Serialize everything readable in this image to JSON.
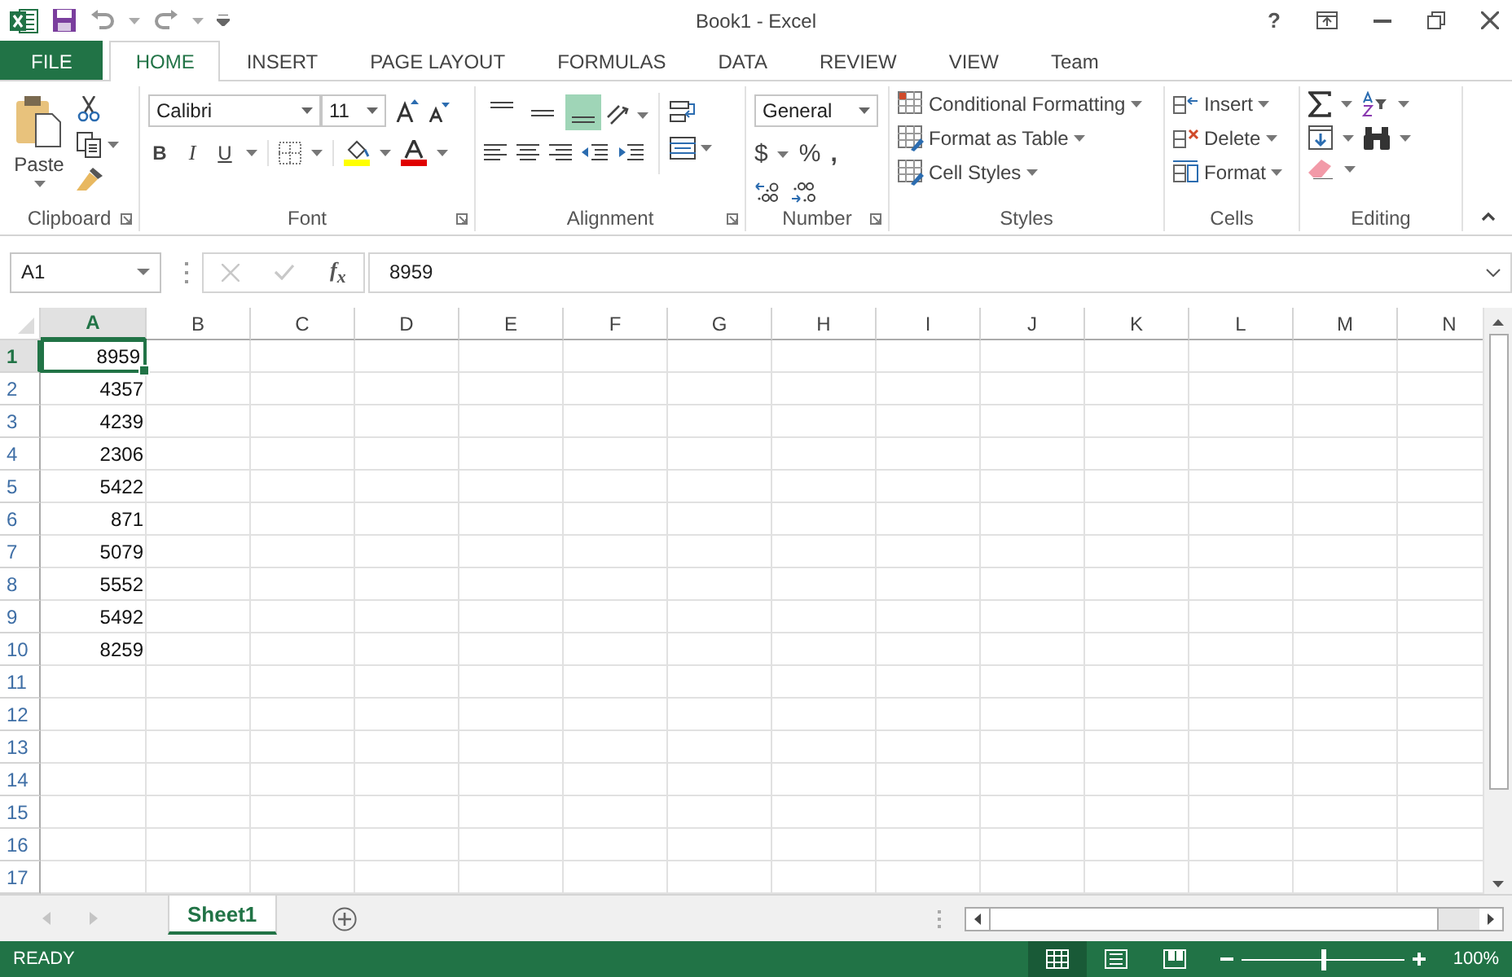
{
  "window": {
    "title": "Book1 - Excel",
    "help": "?"
  },
  "tabs": [
    {
      "label": "FILE",
      "kind": "file",
      "selected": false
    },
    {
      "label": "HOME",
      "kind": "tab",
      "selected": true
    },
    {
      "label": "INSERT",
      "kind": "tab",
      "selected": false
    },
    {
      "label": "PAGE LAYOUT",
      "kind": "tab",
      "selected": false
    },
    {
      "label": "FORMULAS",
      "kind": "tab",
      "selected": false
    },
    {
      "label": "DATA",
      "kind": "tab",
      "selected": false
    },
    {
      "label": "REVIEW",
      "kind": "tab",
      "selected": false
    },
    {
      "label": "VIEW",
      "kind": "tab",
      "selected": false
    },
    {
      "label": "Team",
      "kind": "tab",
      "selected": false
    }
  ],
  "ribbon": {
    "clipboard": {
      "label": "Clipboard",
      "paste": "Paste"
    },
    "font": {
      "label": "Font",
      "font_name": "Calibri",
      "font_size": "11",
      "style_buttons": [
        "B",
        "I",
        "U"
      ]
    },
    "alignment": {
      "label": "Alignment",
      "vertical_buttons": [
        {
          "kind": "top",
          "selected": false
        },
        {
          "kind": "middle",
          "selected": false
        },
        {
          "kind": "bottom",
          "selected": true
        }
      ]
    },
    "number": {
      "label": "Number",
      "format": "General",
      "currency": "$",
      "percent": "%",
      "comma": ","
    },
    "styles": {
      "label": "Styles",
      "items": [
        "Conditional Formatting",
        "Format as Table",
        "Cell Styles"
      ]
    },
    "cells": {
      "label": "Cells",
      "items": [
        "Insert",
        "Delete",
        "Format"
      ]
    },
    "editing": {
      "label": "Editing"
    }
  },
  "formula_bar": {
    "name_box": "A1",
    "fx": "f$_{x}$",
    "value": "8959"
  },
  "columns": [
    {
      "label": "A",
      "selected": true
    },
    {
      "label": "B",
      "selected": false
    },
    {
      "label": "C",
      "selected": false
    },
    {
      "label": "D",
      "selected": false
    },
    {
      "label": "E",
      "selected": false
    },
    {
      "label": "F",
      "selected": false
    },
    {
      "label": "G",
      "selected": false
    },
    {
      "label": "H",
      "selected": false
    },
    {
      "label": "I",
      "selected": false
    },
    {
      "label": "J",
      "selected": false
    },
    {
      "label": "K",
      "selected": false
    },
    {
      "label": "L",
      "selected": false
    },
    {
      "label": "M",
      "selected": false
    },
    {
      "label": "N",
      "selected": false
    }
  ],
  "rows": [
    {
      "number": "1",
      "selected": true,
      "value": "8959"
    },
    {
      "number": "2",
      "selected": false,
      "value": "4357"
    },
    {
      "number": "3",
      "selected": false,
      "value": "4239"
    },
    {
      "number": "4",
      "selected": false,
      "value": "2306"
    },
    {
      "number": "5",
      "selected": false,
      "value": "5422"
    },
    {
      "number": "6",
      "selected": false,
      "value": "871"
    },
    {
      "number": "7",
      "selected": false,
      "value": "5079"
    },
    {
      "number": "8",
      "selected": false,
      "value": "5552"
    },
    {
      "number": "9",
      "selected": false,
      "value": "5492"
    },
    {
      "number": "10",
      "selected": false,
      "value": "8259"
    },
    {
      "number": "11",
      "selected": false
    },
    {
      "number": "12",
      "selected": false
    },
    {
      "number": "13",
      "selected": false
    },
    {
      "number": "14",
      "selected": false
    },
    {
      "number": "15",
      "selected": false
    },
    {
      "number": "16",
      "selected": false
    },
    {
      "number": "17",
      "selected": false
    }
  ],
  "sheets": [
    {
      "label": "Sheet1",
      "selected": true
    }
  ],
  "status_bar": {
    "status": "READY",
    "views": [
      {
        "kind": "normal",
        "selected": true
      },
      {
        "kind": "page_layout",
        "selected": false
      },
      {
        "kind": "page_break",
        "selected": false
      }
    ],
    "zoom": {
      "level": 0.5,
      "reading": "100%"
    }
  }
}
